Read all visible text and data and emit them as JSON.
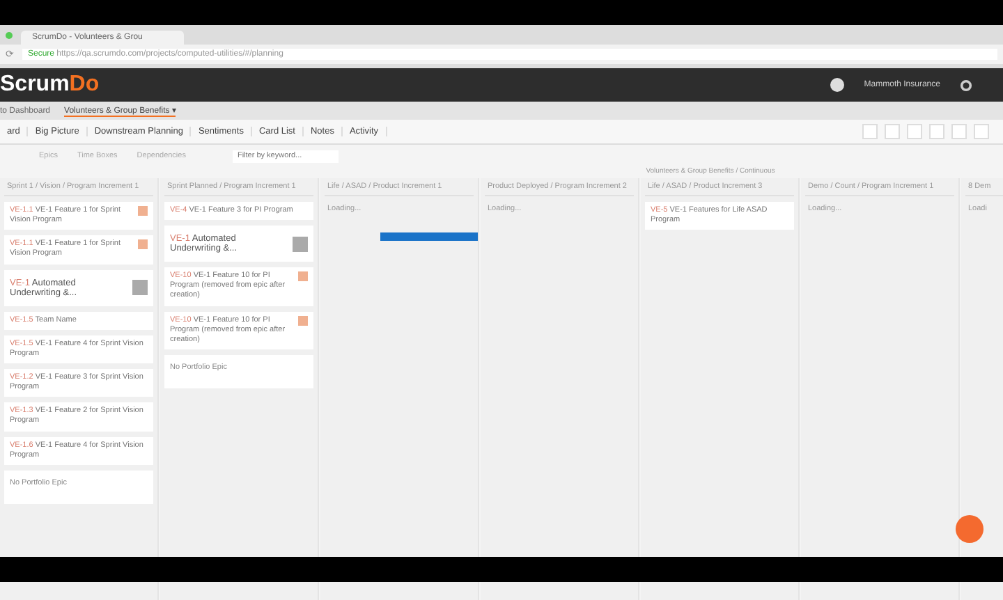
{
  "browser": {
    "tab_title": "ScrumDo - Volunteers & Grou",
    "secure_label": "Secure",
    "url": "https://qa.scrumdo.com/projects/computed-utilities/#/planning",
    "reload_icon": "⟳"
  },
  "header": {
    "logo_a": "Scrum",
    "logo_b": "Do",
    "account": "Mammoth Insurance"
  },
  "breadcrumb": {
    "back": "to Dashboard",
    "project": "Volunteers & Group Benefits",
    "caret": "▾"
  },
  "tabs": [
    "ard",
    "Big Picture",
    "Downstream Planning",
    "Sentiments",
    "Card List",
    "Notes",
    "Activity"
  ],
  "filters": {
    "epics": "Epics",
    "time_boxes": "Time Boxes",
    "dependencies": "Dependencies",
    "search": {
      "placeholder": "Filter by keyword..."
    }
  },
  "group_label": "Volunteers & Group Benefits / Continuous",
  "columns": [
    {
      "title": "Sprint 1 / Vision / Program Increment 1",
      "cards": [
        {
          "kind": "story",
          "id": "VE-1.1",
          "title": "VE-1 Feature 1 for Sprint Vision Program",
          "badge": true
        },
        {
          "kind": "story",
          "id": "VE-1.1",
          "title": "VE-1 Feature 1 for Sprint Vision Program",
          "badge": true
        },
        {
          "kind": "epic",
          "id": "VE-1",
          "title": "Automated Underwriting &..."
        },
        {
          "kind": "story",
          "id": "VE-1.5",
          "title": "Team Name",
          "badge": false
        },
        {
          "kind": "story",
          "id": "VE-1.5",
          "title": "VE-1 Feature 4 for Sprint Vision Program",
          "badge": false
        },
        {
          "kind": "story",
          "id": "VE-1.2",
          "title": "VE-1 Feature 3 for Sprint Vision Program",
          "badge": false
        },
        {
          "kind": "story",
          "id": "VE-1.3",
          "title": "VE-1 Feature 2 for Sprint Vision Program",
          "badge": false
        },
        {
          "kind": "story",
          "id": "VE-1.6",
          "title": "VE-1 Feature 4 for Sprint Vision Program",
          "badge": false
        },
        {
          "kind": "empty",
          "title": "No Portfolio Epic"
        }
      ]
    },
    {
      "title": "Sprint Planned / Program Increment 1",
      "cards": [
        {
          "kind": "story",
          "id": "VE-4",
          "title": "VE-1 Feature 3 for PI Program",
          "badge": false
        },
        {
          "kind": "epic",
          "id": "VE-1",
          "title": "Automated Underwriting &..."
        },
        {
          "kind": "story",
          "id": "VE-10",
          "title": "VE-1 Feature 10 for PI Program (removed from epic after creation)",
          "badge": true
        },
        {
          "kind": "story",
          "id": "VE-10",
          "title": "VE-1 Feature 10 for PI Program (removed from epic after creation)",
          "badge": true
        },
        {
          "kind": "empty",
          "title": "No Portfolio Epic"
        }
      ]
    },
    {
      "title": "Life / ASAD / Product Increment 1",
      "loading_label": "Loading...",
      "progress_bar": true
    },
    {
      "title": "Product Deployed / Program Increment 2",
      "loading_label": "Loading..."
    },
    {
      "title": "Life / ASAD / Product Increment 3",
      "cards": [
        {
          "kind": "story",
          "id": "VE-5",
          "title": "VE-1 Features for Life ASAD Program",
          "badge": false
        }
      ]
    },
    {
      "title": "Demo / Count / Program Increment 1",
      "loading_label": "Loading..."
    },
    {
      "title": "8 Dem",
      "loading_label": "Loadi"
    }
  ]
}
